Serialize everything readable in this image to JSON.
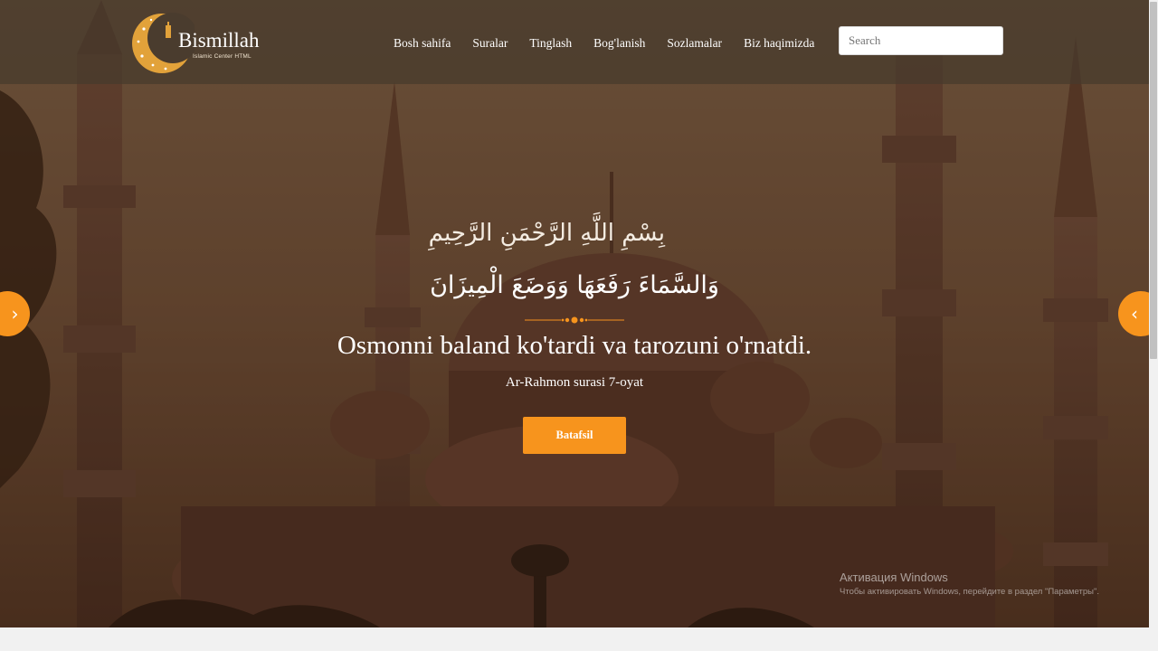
{
  "colors": {
    "accent": "#f7941d",
    "navbar_bg": "#463a2c",
    "text": "#ffffff"
  },
  "brand": {
    "name": "Bismillah",
    "tagline": "Islamic Center HTML",
    "icon": "crescent-mosque-icon"
  },
  "nav": {
    "items": [
      {
        "label": "Bosh sahifa"
      },
      {
        "label": "Suralar"
      },
      {
        "label": "Tinglash"
      },
      {
        "label": "Bog'lanish"
      },
      {
        "label": "Sozlamalar"
      },
      {
        "label": "Biz haqimizda"
      }
    ]
  },
  "search": {
    "placeholder": "Search",
    "value": ""
  },
  "slide": {
    "bismillah": "بِسْمِ اللَّهِ الرَّحْمَنِ الرَّحِيمِ",
    "arabic": "وَالسَّمَاءَ رَفَعَهَا وَوَضَعَ الْمِيزَانَ",
    "translation": "Osmonni baland ko'tardi va tarozuni o'rnatdi.",
    "reference": "Ar-Rahmon surasi 7-oyat",
    "button_label": "Batafsil",
    "prev_icon": "chevron-right-icon",
    "next_icon": "chevron-left-icon",
    "prev_glyph": "›",
    "next_glyph": "‹"
  },
  "windows_activation": {
    "title": "Активация Windows",
    "subtitle": "Чтобы активировать Windows, перейдите в раздел \"Параметры\"."
  }
}
